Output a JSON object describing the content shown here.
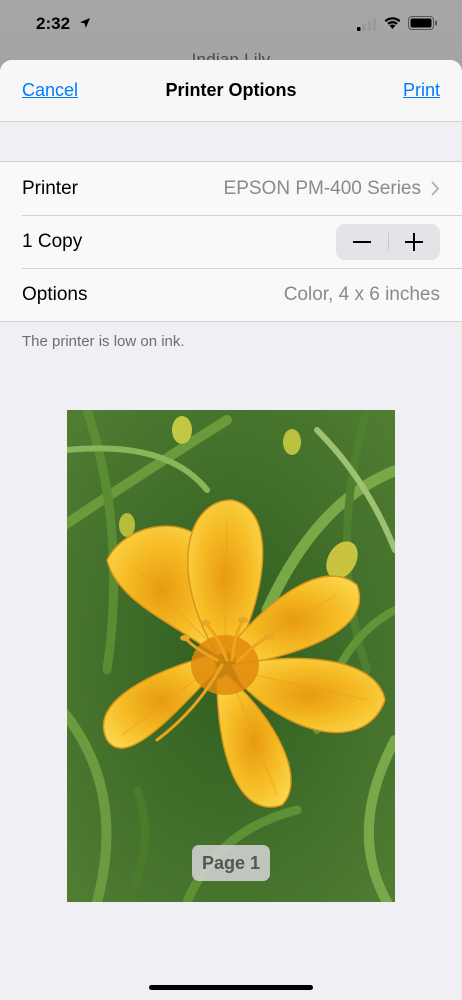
{
  "status_bar": {
    "time": "2:32",
    "icons": [
      "location-arrow-icon",
      "cellular-signal-icon",
      "wifi-icon",
      "battery-icon"
    ]
  },
  "background_app": {
    "title_partial": "Indian Lily"
  },
  "nav": {
    "cancel_label": "Cancel",
    "title": "Printer Options",
    "print_label": "Print"
  },
  "rows": {
    "printer": {
      "label": "Printer",
      "value": "EPSON PM-400 Series"
    },
    "copies": {
      "label": "1 Copy",
      "decrement": "−",
      "increment": "+"
    },
    "options": {
      "label": "Options",
      "value": "Color, 4 x 6 inches"
    }
  },
  "note": "The printer is low on ink.",
  "preview": {
    "page_label": "Page 1",
    "image_subject": "yellow daylily flower with green foliage"
  },
  "colors": {
    "accent": "#007aff",
    "sheet_bg": "#efeff4",
    "flower": "#f5b922"
  }
}
